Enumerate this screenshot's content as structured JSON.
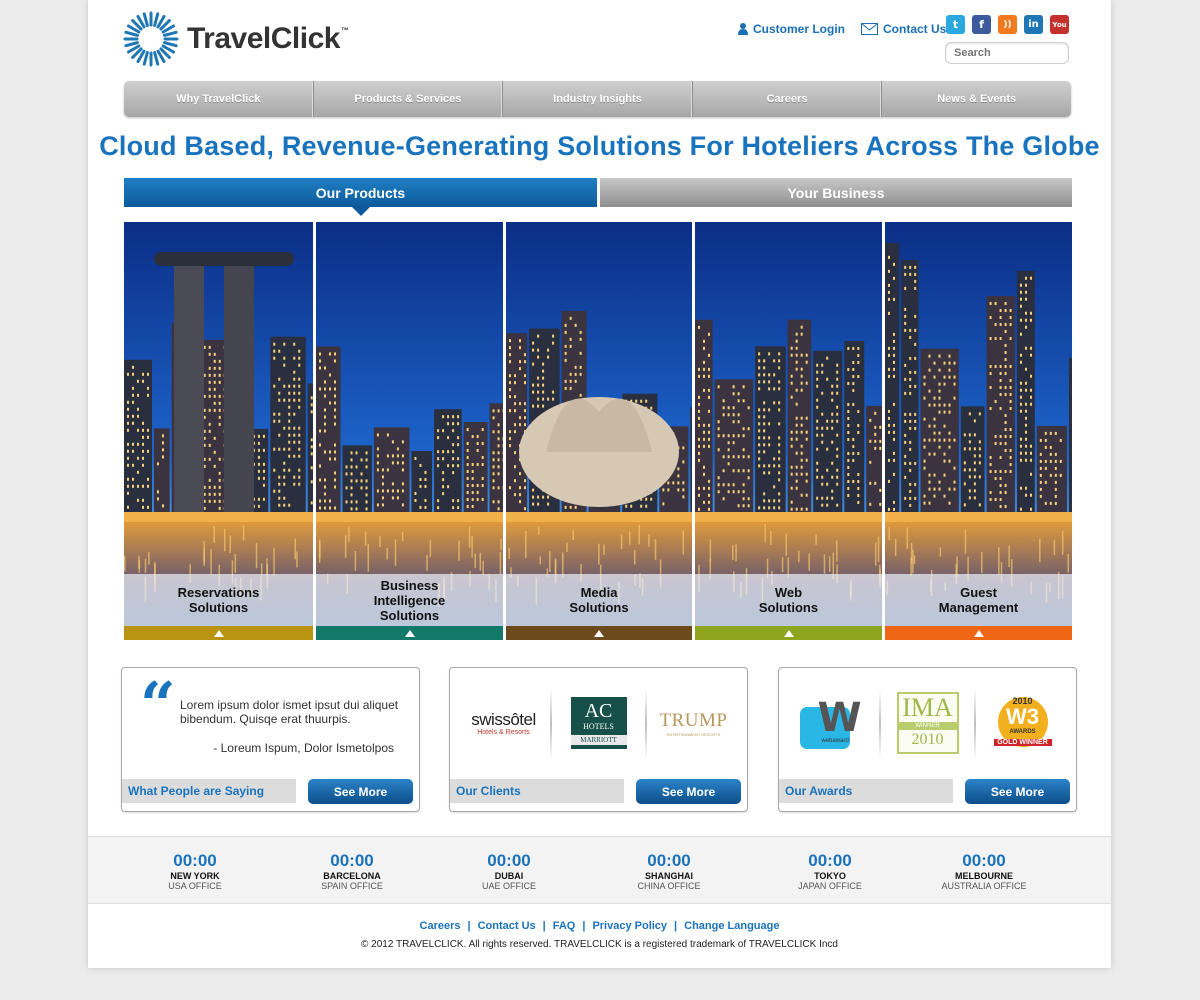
{
  "brand": {
    "name": "TravelClick",
    "tm": "™"
  },
  "header": {
    "customer_login": "Customer Login",
    "contact_us": "Contact Us",
    "search_placeholder": "Search",
    "social": [
      {
        "name": "twitter-icon",
        "glyph": "t",
        "color": "#2aa9e0"
      },
      {
        "name": "facebook-icon",
        "glyph": "f",
        "color": "#3b5b9e"
      },
      {
        "name": "rss-icon",
        "glyph": "))",
        "color": "#f07a1d"
      },
      {
        "name": "linkedin-icon",
        "glyph": "in",
        "color": "#1f77b4"
      },
      {
        "name": "youtube-icon",
        "glyph": "You",
        "color": "#c4302b"
      }
    ]
  },
  "nav": {
    "items": [
      "Why TravelClick",
      "Products & Services",
      "Industry Insights",
      "Careers",
      "News & Events"
    ]
  },
  "headline": "Cloud Based, Revenue-Generating Solutions For Hoteliers Across The Globe",
  "tabs": {
    "products": "Our Products",
    "business": "Your Business"
  },
  "panels": [
    {
      "lines": [
        "Reservations",
        "Solutions"
      ],
      "color": "#b89410"
    },
    {
      "lines": [
        "Business",
        "Intelligence",
        "Solutions"
      ],
      "color": "#137a69"
    },
    {
      "lines": [
        "Media",
        "Solutions"
      ],
      "color": "#6c4a1c"
    },
    {
      "lines": [
        "Web",
        "Solutions"
      ],
      "color": "#8fa51d"
    },
    {
      "lines": [
        "Guest",
        "Management"
      ],
      "color": "#ef6714"
    }
  ],
  "testimonial": {
    "quote_mark": "“",
    "text": "Lorem ipsum dolor ismet ipsut dui aliquet bibendum. Quisqe erat thuurpis.",
    "author": "- Loreum Ispum, Dolor Ismetolpos",
    "label": "What People are Saying",
    "button": "See More"
  },
  "clients": {
    "label": "Our Clients",
    "button": "See More",
    "logos": {
      "swissotel": "swissôtel",
      "swissotel_sub": "Hotels & Resorts",
      "ac_top": "AC",
      "ac_mid": "HOTELS",
      "ac_bottom": "MARRIOTT",
      "trump": "TRUMP",
      "trump_sub": "ENTERTAINMENT RESORTS"
    }
  },
  "awards": {
    "label": "Our Awards",
    "button": "See More",
    "logos": {
      "webaward": "webaward",
      "ima": "IMA",
      "ima_winner": "WINNER",
      "ima_year": "2010",
      "w3_year": "2010",
      "w3_awards": "AWARDS",
      "w3_gold": "GOLD WINNER"
    }
  },
  "clocks": [
    {
      "time": "00:00",
      "city": "NEW YORK",
      "office": "USA OFFICE"
    },
    {
      "time": "00:00",
      "city": "BARCELONA",
      "office": "SPAIN OFFICE"
    },
    {
      "time": "00:00",
      "city": "DUBAI",
      "office": "UAE OFFICE"
    },
    {
      "time": "00:00",
      "city": "SHANGHAI",
      "office": "CHINA OFFICE"
    },
    {
      "time": "00:00",
      "city": "TOKYO",
      "office": "JAPAN OFFICE"
    },
    {
      "time": "00:00",
      "city": "MELBOURNE",
      "office": "AUSTRALIA OFFICE"
    }
  ],
  "footer": {
    "links": [
      "Careers",
      "Contact Us",
      "FAQ",
      "Privacy Policy",
      "Change Language"
    ],
    "separator": "|",
    "copyright": "© 2012 TRAVELCLICK. All rights reserved. TRAVELCLICK is a registered trademark of TRAVELCLICK Incd"
  }
}
